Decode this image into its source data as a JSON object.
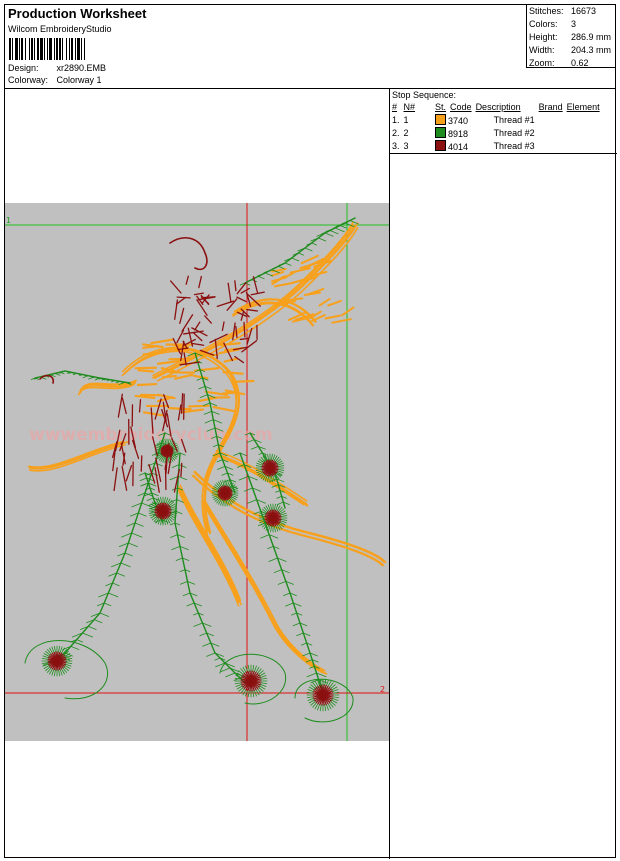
{
  "header": {
    "title": "Production Worksheet",
    "software": "Wilcom EmbroideryStudio",
    "design_label": "Design:",
    "design_value": "xr2890.EMB",
    "colorway_label": "Colorway:",
    "colorway_value": "Colorway 1"
  },
  "stats": {
    "stitches_label": "Stitches:",
    "stitches_value": "16673",
    "colors_label": "Colors:",
    "colors_value": "3",
    "height_label": "Height:",
    "height_value": "286.9 mm",
    "width_label": "Width:",
    "width_value": "204.3 mm",
    "zoom_label": "Zoom:",
    "zoom_value": "0.62"
  },
  "stop_sequence": {
    "caption": "Stop Sequence:",
    "headers": [
      "#",
      "N#",
      "St.",
      "Code",
      "Description",
      "Brand",
      "Element"
    ],
    "rows": [
      {
        "num": "1.",
        "n": "1",
        "code": "3740",
        "description": "Thread #1",
        "color": "#f7a01c"
      },
      {
        "num": "2.",
        "n": "2",
        "code": "8918",
        "description": "Thread #2",
        "color": "#1e8c1e"
      },
      {
        "num": "3.",
        "n": "3",
        "code": "4014",
        "description": "Thread #3",
        "color": "#8b1010"
      }
    ]
  },
  "design_view": {
    "marker_start": "1",
    "marker_end": "2",
    "watermark": "wwwembroideryclub.com",
    "thread_colors": [
      "#f7a01c",
      "#1e8c1e",
      "#8b1010"
    ]
  }
}
